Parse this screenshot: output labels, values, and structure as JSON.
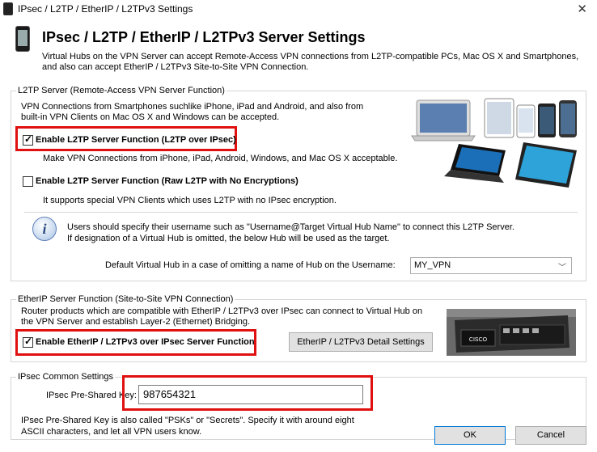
{
  "window": {
    "title": "IPsec / L2TP / EtherIP / L2TPv3 Settings",
    "close_glyph": "✕"
  },
  "header": {
    "title": "IPsec / L2TP / EtherIP / L2TPv3 Server Settings",
    "desc_line1": "Virtual Hubs on the VPN Server can accept Remote-Access VPN connections from L2TP-compatible PCs, Mac OS X and Smartphones,",
    "desc_line2": "and also can accept EtherIP / L2TPv3 Site-to-Site VPN Connection."
  },
  "l2tp": {
    "legend": "L2TP Server (Remote-Access VPN Server Function)",
    "intro_line1": "VPN Connections from Smartphones suchlike iPhone, iPad and Android, and also from",
    "intro_line2": "built-in VPN Clients on Mac OS X and Windows can be accepted.",
    "ipsec_checkbox_label": "Enable L2TP Server Function (L2TP over IPsec)",
    "ipsec_checked": true,
    "ipsec_desc": "Make VPN Connections from iPhone, iPad, Android, Windows, and Mac OS X acceptable.",
    "raw_checkbox_label": "Enable L2TP Server Function (Raw L2TP with No Encryptions)",
    "raw_checked": false,
    "raw_desc": "It supports special VPN Clients which uses L2TP with no IPsec encryption.",
    "info_line1": "Users should specify their username such as \"Username@Target Virtual Hub Name\" to connect this L2TP Server.",
    "info_line2": "If designation of a Virtual Hub is omitted, the below Hub will be used as the target.",
    "default_hub_label": "Default Virtual Hub in a case of omitting a name of Hub on the Username:",
    "default_hub_value": "MY_VPN"
  },
  "etherip": {
    "legend": "EtherIP Server Function (Site-to-Site VPN Connection)",
    "desc_line1": "Router products which are compatible with EtherIP / L2TPv3 over IPsec can connect to Virtual Hub on",
    "desc_line2": "the VPN Server and establish Layer-2 (Ethernet) Bridging.",
    "checkbox_label": "Enable EtherIP / L2TPv3 over IPsec Server Function",
    "checked": true,
    "detail_button": "EtherIP / L2TPv3 Detail Settings",
    "router_brand": "CISCO"
  },
  "ipsec_common": {
    "legend": "IPsec Common Settings",
    "psk_label": "IPsec Pre-Shared Key:",
    "psk_value": "987654321",
    "note_line1": "IPsec Pre-Shared Key is also called \"PSKs\" or \"Secrets\". Specify it with around eight",
    "note_line2": "ASCII characters, and let all VPN users know."
  },
  "footer": {
    "ok_label": "OK",
    "cancel_label": "Cancel"
  },
  "colors": {
    "highlight": "#e01010",
    "accent": "#0078d7"
  }
}
